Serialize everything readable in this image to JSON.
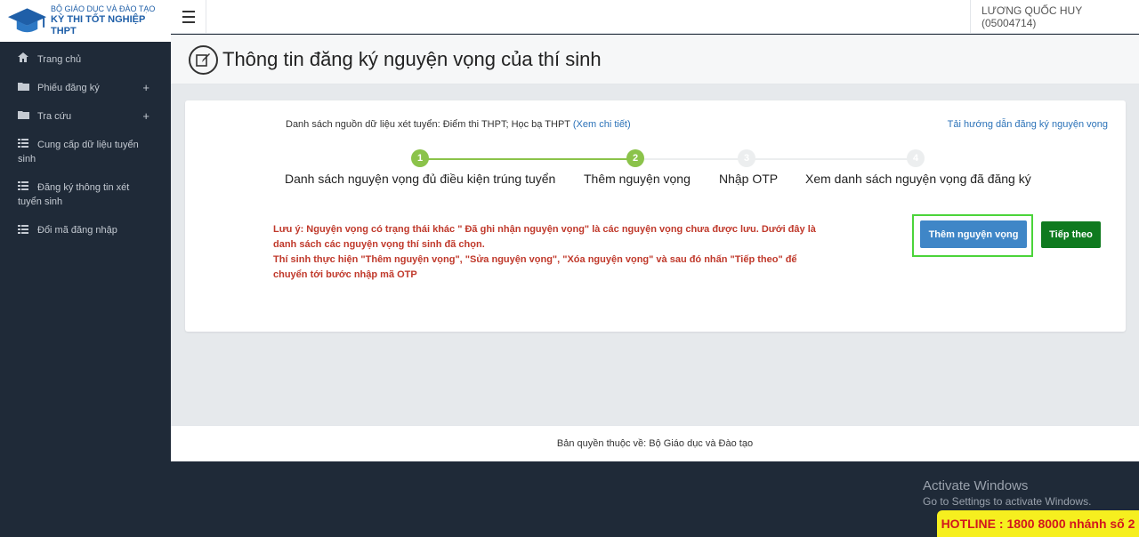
{
  "brand": {
    "line1": "BỘ GIÁO DỤC VÀ ĐÀO TẠO",
    "line2": "KỲ THI TỐT NGHIỆP THPT"
  },
  "sidebar": {
    "items": [
      {
        "label": "Trang chủ",
        "icon": "home-icon"
      },
      {
        "label": "Phiếu đăng ký",
        "icon": "folder-icon",
        "expand": "+"
      },
      {
        "label": "Tra cứu",
        "icon": "folder-icon",
        "expand": "+"
      },
      {
        "label": "Cung cấp dữ liệu tuyển sinh",
        "icon": "list-icon"
      },
      {
        "label": "Đăng ký thông tin xét tuyển sinh",
        "icon": "list-icon"
      },
      {
        "label": "Đổi mã đăng nhập",
        "icon": "list-icon"
      }
    ]
  },
  "header": {
    "user": "LƯƠNG QUỐC HUY (05004714)"
  },
  "page": {
    "title": "Thông tin đăng ký nguyện vọng của thí sinh"
  },
  "main": {
    "source_text": "Danh sách nguồn dữ liệu xét tuyển: Điểm thi THPT; Học bạ THPT ",
    "source_link": "(Xem chi tiết)",
    "guide_link": "Tải hướng dẫn đăng ký nguyện vọng",
    "steps": [
      {
        "number": "1",
        "label": "Danh sách nguyện vọng đủ điều kiện trúng tuyển",
        "state": "active"
      },
      {
        "number": "2",
        "label": "Thêm nguyện vọng",
        "state": "active"
      },
      {
        "number": "3",
        "label": "Nhập OTP",
        "state": "inactive"
      },
      {
        "number": "4",
        "label": "Xem danh sách nguyện vọng đã đăng ký",
        "state": "inactive"
      }
    ],
    "note_line1": "Lưu ý: Nguyện vọng có trạng thái khác \" Đã ghi nhận nguyện vọng\" là các nguyện vọng chưa được lưu. Dưới đây là danh sách các nguyện vọng thí sinh đã chọn.",
    "note_line2": "Thí sinh thực hiện \"Thêm nguyện vọng\", \"Sửa nguyện vọng\", \"Xóa nguyện vọng\" và sau đó nhấn \"Tiếp theo\" để chuyển tới bước nhập mã OTP",
    "add_button": "Thêm nguyện vọng",
    "next_button": "Tiếp theo"
  },
  "footer": {
    "copyright": "Bản quyền thuộc về: Bộ Giáo dục và Đào tạo"
  },
  "watermark": {
    "line1": "Activate Windows",
    "line2": "Go to Settings to activate Windows."
  },
  "hotline": "HOTLINE : 1800 8000 nhánh số 2",
  "colors": {
    "sidebar": "#1f2a38",
    "step_active": "#8bc34a",
    "add_button": "#3f86c7",
    "next_button": "#0f7a1f",
    "note": "#c0392b",
    "highlight_border": "#4bd43a",
    "hotline_bg": "#f6ef1f"
  }
}
